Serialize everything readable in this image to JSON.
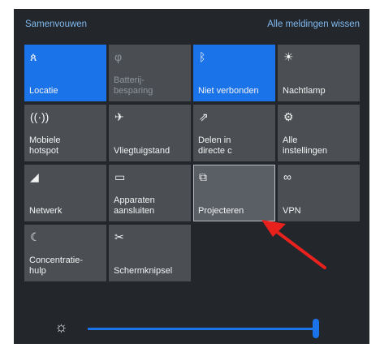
{
  "header": {
    "collapse_label": "Samenvouwen",
    "clear_all_label": "Alle meldingen wissen"
  },
  "tiles": [
    {
      "label": "Locatie",
      "icon": "location-icon"
    },
    {
      "label": "Batterij-\nbesparing",
      "icon": "battery-saver-icon"
    },
    {
      "label": "Niet verbonden",
      "icon": "bluetooth-icon"
    },
    {
      "label": "Nachtlamp",
      "icon": "night-light-icon"
    },
    {
      "label": "Mobiele\nhotspot",
      "icon": "hotspot-icon"
    },
    {
      "label": "Vliegtuigstand",
      "icon": "airplane-icon"
    },
    {
      "label": "Delen in\ndirecte c",
      "icon": "share-icon"
    },
    {
      "label": "Alle\ninstellingen",
      "icon": "settings-icon"
    },
    {
      "label": "Netwerk",
      "icon": "network-icon"
    },
    {
      "label": "Apparaten\naansluiten",
      "icon": "connect-devices-icon"
    },
    {
      "label": "Projecteren",
      "icon": "project-icon"
    },
    {
      "label": "VPN",
      "icon": "vpn-icon"
    },
    {
      "label": "Concentratie-\nhulp",
      "icon": "focus-assist-icon"
    },
    {
      "label": "Schermknipsel",
      "icon": "screen-snip-icon"
    }
  ],
  "brightness": {
    "icon": "brightness-icon",
    "value": 0.97
  },
  "colors": {
    "accent": "#1a73e8",
    "annotation_arrow": "#e8211d"
  }
}
